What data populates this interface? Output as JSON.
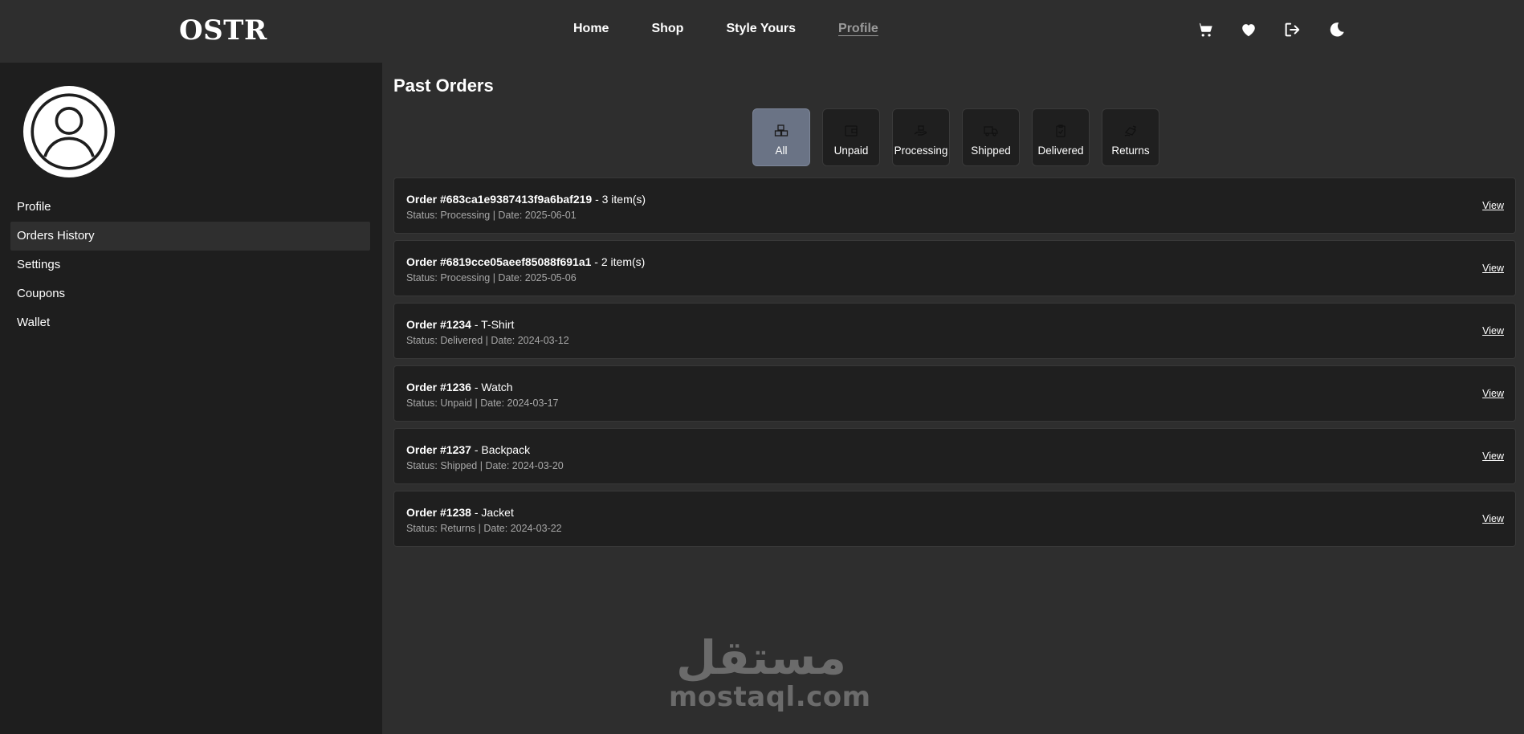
{
  "brand": {
    "logo": "OSTR"
  },
  "nav": {
    "items": [
      {
        "label": "Home",
        "active": false
      },
      {
        "label": "Shop",
        "active": false
      },
      {
        "label": "Style Yours",
        "active": false
      },
      {
        "label": "Profile",
        "active": true
      }
    ]
  },
  "header_icons": [
    "cart-icon",
    "heart-icon",
    "logout-icon",
    "moon-icon"
  ],
  "sidebar": {
    "items": [
      {
        "label": "Profile",
        "active": false
      },
      {
        "label": "Orders History",
        "active": true
      },
      {
        "label": "Settings",
        "active": false
      },
      {
        "label": "Coupons",
        "active": false
      },
      {
        "label": "Wallet",
        "active": false
      }
    ]
  },
  "main": {
    "title": "Past Orders",
    "filters": [
      {
        "label": "All",
        "active": true
      },
      {
        "label": "Unpaid",
        "active": false
      },
      {
        "label": "Processing",
        "active": false
      },
      {
        "label": "Shipped",
        "active": false
      },
      {
        "label": "Delivered",
        "active": false
      },
      {
        "label": "Returns",
        "active": false
      }
    ],
    "orders": [
      {
        "id": "Order #683ca1e9387413f9a6baf219",
        "detail": " - 3 item(s)",
        "meta": "Status: Processing | Date: 2025-06-01",
        "action": "View"
      },
      {
        "id": "Order #6819cce05aeef85088f691a1",
        "detail": " - 2 item(s)",
        "meta": "Status: Processing | Date: 2025-05-06",
        "action": "View"
      },
      {
        "id": "Order #1234",
        "detail": " - T-Shirt",
        "meta": "Status: Delivered | Date: 2024-03-12",
        "action": "View"
      },
      {
        "id": "Order #1236",
        "detail": " - Watch",
        "meta": "Status: Unpaid | Date: 2024-03-17",
        "action": "View"
      },
      {
        "id": "Order #1237",
        "detail": " - Backpack",
        "meta": "Status: Shipped | Date: 2024-03-20",
        "action": "View"
      },
      {
        "id": "Order #1238",
        "detail": " - Jacket",
        "meta": "Status: Returns | Date: 2024-03-22",
        "action": "View"
      }
    ]
  },
  "watermark": {
    "arabic": "مستقل",
    "latin": "mostaql.com"
  },
  "colors": {
    "page_bg": "#2e2e2e",
    "sidebar_bg": "#1e1e1e",
    "card_bg": "#1f1f1f",
    "active_filter": "#6a7385",
    "muted_text": "#a8a8a8"
  }
}
